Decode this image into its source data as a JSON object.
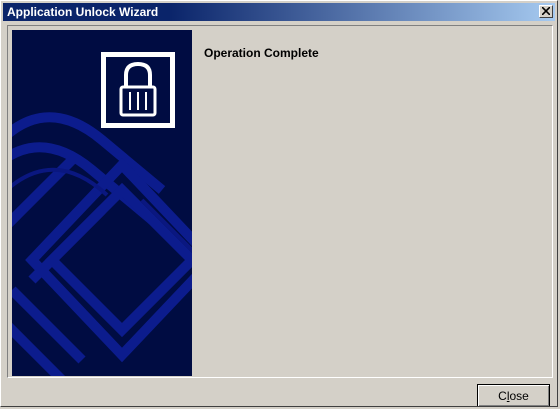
{
  "window": {
    "title": "Application Unlock Wizard",
    "close_glyph": "x"
  },
  "content": {
    "heading": "Operation Complete"
  },
  "footer": {
    "close_label_prefix": "C",
    "close_label_mnemonic": "l",
    "close_label_suffix": "ose"
  },
  "colors": {
    "titlebar_start": "#0a246a",
    "titlebar_end": "#a6caf0",
    "side_panel": "#000c42",
    "side_graphic": "#0e1e96",
    "dialog_face": "#d4d0c8"
  },
  "icons": {
    "side_logo": "padlock-icon",
    "close": "close-icon"
  }
}
